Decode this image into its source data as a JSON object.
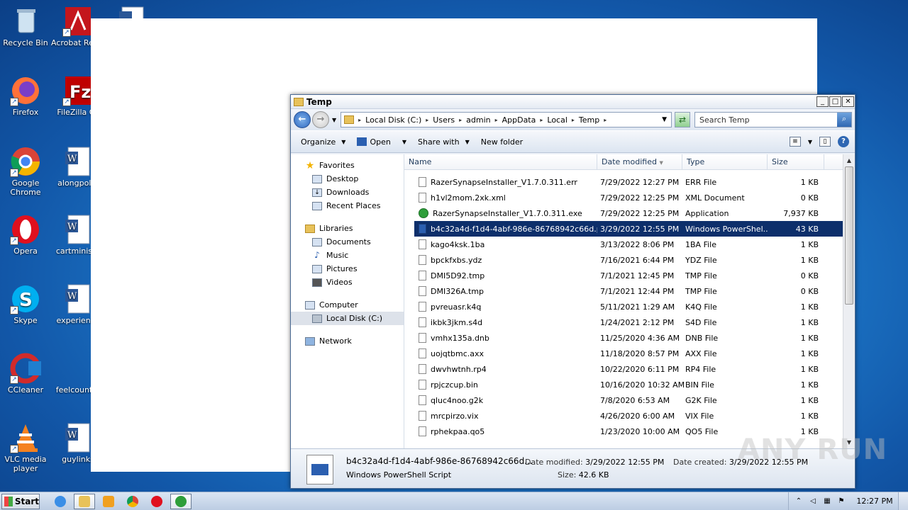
{
  "desktop": {
    "icons": [
      {
        "label": "Recycle Bin"
      },
      {
        "label": "Acrobat Reader D"
      },
      {
        "label": "Firefox"
      },
      {
        "label": "FileZilla Cli"
      },
      {
        "label": "Google Chrome"
      },
      {
        "label": "alongpoliti"
      },
      {
        "label": "Opera"
      },
      {
        "label": "cartministe"
      },
      {
        "label": "Skype"
      },
      {
        "label": "experience"
      },
      {
        "label": "CCleaner"
      },
      {
        "label": "feelcountry"
      },
      {
        "label": "VLC media player"
      },
      {
        "label": "guylinks"
      }
    ]
  },
  "explorer": {
    "title": "Temp",
    "address": {
      "crumbs": [
        "Local Disk (C:)",
        "Users",
        "admin",
        "AppData",
        "Local",
        "Temp"
      ]
    },
    "search": {
      "placeholder": "Search Temp"
    },
    "toolbar": {
      "organize": "Organize",
      "open": "Open",
      "share_with": "Share with",
      "new_folder": "New folder"
    },
    "nav": {
      "favorites": "Favorites",
      "desktop": "Desktop",
      "downloads": "Downloads",
      "recent_places": "Recent Places",
      "libraries": "Libraries",
      "documents": "Documents",
      "music": "Music",
      "pictures": "Pictures",
      "videos": "Videos",
      "computer": "Computer",
      "local_disk": "Local Disk (C:)",
      "network": "Network"
    },
    "columns": {
      "name": "Name",
      "date": "Date modified",
      "type": "Type",
      "size": "Size"
    },
    "files": [
      {
        "name": "RazerSynapseInstaller_V1.7.0.311.err",
        "date": "7/29/2022 12:27 PM",
        "type": "ERR File",
        "size": "1 KB",
        "icon": "file"
      },
      {
        "name": "h1vl2mom.2xk.xml",
        "date": "7/29/2022 12:25 PM",
        "type": "XML Document",
        "size": "0 KB",
        "icon": "file"
      },
      {
        "name": "RazerSynapseInstaller_V1.7.0.311.exe",
        "date": "7/29/2022 12:25 PM",
        "type": "Application",
        "size": "7,937 KB",
        "icon": "exe"
      },
      {
        "name": "b4c32a4d-f1d4-4abf-986e-86768942c66d.ps1",
        "date": "3/29/2022 12:55 PM",
        "type": "Windows PowerShel...",
        "size": "43 KB",
        "icon": "ps1",
        "selected": true
      },
      {
        "name": "kago4ksk.1ba",
        "date": "3/13/2022 8:06 PM",
        "type": "1BA File",
        "size": "1 KB",
        "icon": "file"
      },
      {
        "name": "bpckfxbs.ydz",
        "date": "7/16/2021 6:44 PM",
        "type": "YDZ File",
        "size": "1 KB",
        "icon": "file"
      },
      {
        "name": "DMI5D92.tmp",
        "date": "7/1/2021 12:45 PM",
        "type": "TMP File",
        "size": "0 KB",
        "icon": "file"
      },
      {
        "name": "DMI326A.tmp",
        "date": "7/1/2021 12:44 PM",
        "type": "TMP File",
        "size": "0 KB",
        "icon": "file"
      },
      {
        "name": "pvreuasr.k4q",
        "date": "5/11/2021 1:29 AM",
        "type": "K4Q File",
        "size": "1 KB",
        "icon": "file"
      },
      {
        "name": "ikbk3jkm.s4d",
        "date": "1/24/2021 2:12 PM",
        "type": "S4D File",
        "size": "1 KB",
        "icon": "file"
      },
      {
        "name": "vmhx135a.dnb",
        "date": "11/25/2020 4:36 AM",
        "type": "DNB File",
        "size": "1 KB",
        "icon": "file"
      },
      {
        "name": "uojqtbmc.axx",
        "date": "11/18/2020 8:57 PM",
        "type": "AXX File",
        "size": "1 KB",
        "icon": "file"
      },
      {
        "name": "dwvhwtnh.rp4",
        "date": "10/22/2020 6:11 PM",
        "type": "RP4 File",
        "size": "1 KB",
        "icon": "file"
      },
      {
        "name": "rpjczcup.bin",
        "date": "10/16/2020 10:32 AM",
        "type": "BIN File",
        "size": "1 KB",
        "icon": "file"
      },
      {
        "name": "qluc4noo.g2k",
        "date": "7/8/2020 6:53 AM",
        "type": "G2K File",
        "size": "1 KB",
        "icon": "file"
      },
      {
        "name": "mrcpirzo.vix",
        "date": "4/26/2020 6:00 AM",
        "type": "VIX File",
        "size": "1 KB",
        "icon": "file"
      },
      {
        "name": "rphekpaa.qo5",
        "date": "1/23/2020 10:00 AM",
        "type": "QO5 File",
        "size": "1 KB",
        "icon": "file"
      }
    ],
    "details": {
      "filename": "b4c32a4d-f1d4-4abf-986e-86768942c66d...",
      "filetype": "Windows PowerShell Script",
      "date_modified_label": "Date modified:",
      "date_modified": "3/29/2022 12:55 PM",
      "size_label": "Size:",
      "size": "42.6 KB",
      "date_created_label": "Date created:",
      "date_created": "3/29/2022 12:55 PM"
    }
  },
  "taskbar": {
    "start_label": "Start",
    "clock": "12:27 PM"
  },
  "watermark": "ANY RUN"
}
